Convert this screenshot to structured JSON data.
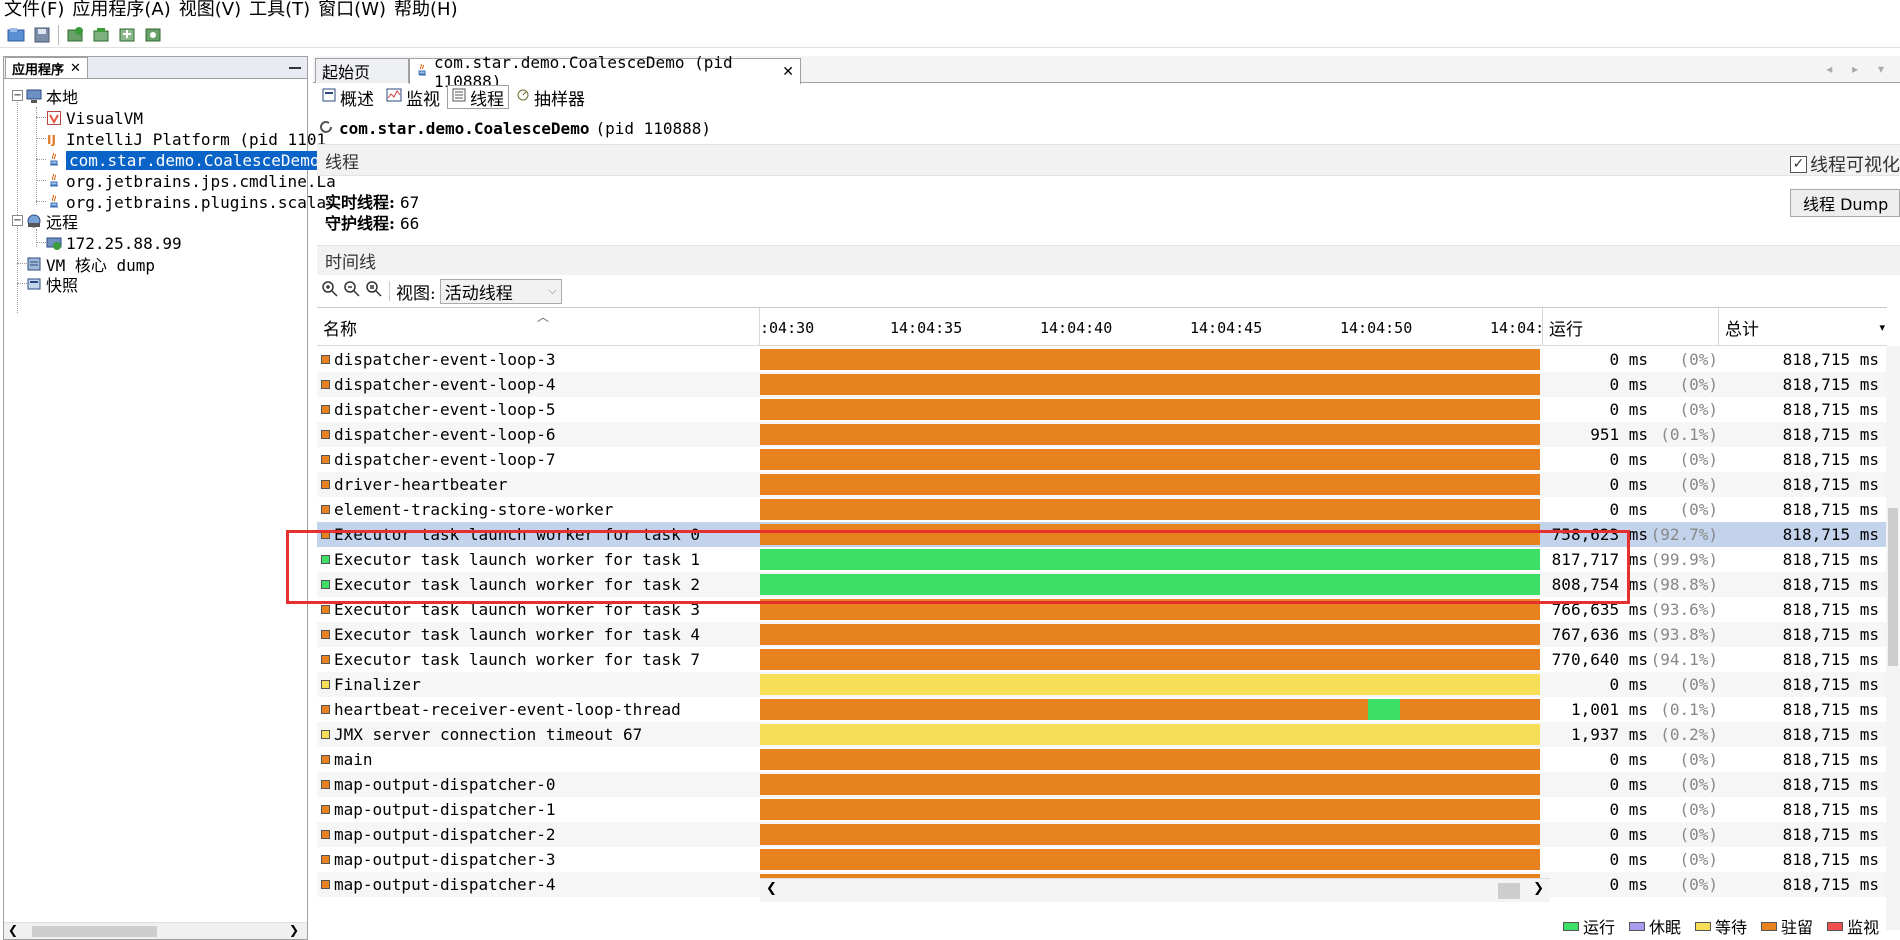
{
  "menu": [
    "文件(F)",
    "应用程序(A)",
    "视图(V)",
    "工具(T)",
    "窗口(W)",
    "帮助(H)"
  ],
  "left_panel": {
    "tab_label": "应用程序",
    "local": "本地",
    "local_items": [
      "VisualVM",
      "IntelliJ Platform (pid 1101",
      "com.star.demo.CoalesceDemo",
      "org.jetbrains.jps.cmdline.La",
      "org.jetbrains.plugins.scala."
    ],
    "remote": "远程",
    "remote_items": [
      "172.25.88.99"
    ],
    "vm_core_dump": "VM 核心 dump",
    "snapshots": "快照"
  },
  "doc_tabs": {
    "start_page": "起始页",
    "app_tab": "com.star.demo.CoalesceDemo (pid 110888)"
  },
  "sub_tabs": [
    "概述",
    "监视",
    "线程",
    "抽样器"
  ],
  "app_header": {
    "name": "com.star.demo.CoalesceDemo",
    "pid": "(pid 110888)"
  },
  "threads_section": {
    "title": "线程",
    "visualize_label": "线程可视化",
    "live_label": "实时线程:",
    "live_value": "67",
    "daemon_label": "守护线程:",
    "daemon_value": "66",
    "dump_button": "线程 Dump"
  },
  "timeline_section": {
    "title": "时间线",
    "view_label": "视图:",
    "view_value": "活动线程"
  },
  "table": {
    "col_name": "名称",
    "col_running": "运行",
    "col_total": "总计",
    "ticks": [
      ":04:30",
      "14:04:35",
      "14:04:40",
      "14:04:45",
      "14:04:50",
      "14:04:"
    ],
    "rows": [
      {
        "name": "dispatcher-event-loop-3",
        "state": "park",
        "run": "0 ms",
        "pct": "(0%)",
        "total": "818,715 ms"
      },
      {
        "name": "dispatcher-event-loop-4",
        "state": "park",
        "run": "0 ms",
        "pct": "(0%)",
        "total": "818,715 ms"
      },
      {
        "name": "dispatcher-event-loop-5",
        "state": "park",
        "run": "0 ms",
        "pct": "(0%)",
        "total": "818,715 ms"
      },
      {
        "name": "dispatcher-event-loop-6",
        "state": "park",
        "run": "951 ms",
        "pct": "(0.1%)",
        "total": "818,715 ms"
      },
      {
        "name": "dispatcher-event-loop-7",
        "state": "park",
        "run": "0 ms",
        "pct": "(0%)",
        "total": "818,715 ms"
      },
      {
        "name": "driver-heartbeater",
        "state": "park",
        "run": "0 ms",
        "pct": "(0%)",
        "total": "818,715 ms"
      },
      {
        "name": "element-tracking-store-worker",
        "state": "park",
        "run": "0 ms",
        "pct": "(0%)",
        "total": "818,715 ms"
      },
      {
        "name": "Executor task launch worker for task 0",
        "state": "park",
        "run": "758,623 ms",
        "pct": "(92.7%)",
        "total": "818,715 ms",
        "selected": true
      },
      {
        "name": "Executor task launch worker for task 1",
        "state": "run",
        "run": "817,717 ms",
        "pct": "(99.9%)",
        "total": "818,715 ms"
      },
      {
        "name": "Executor task launch worker for task 2",
        "state": "run",
        "run": "808,754 ms",
        "pct": "(98.8%)",
        "total": "818,715 ms"
      },
      {
        "name": "Executor task launch worker for task 3",
        "state": "park",
        "run": "766,635 ms",
        "pct": "(93.6%)",
        "total": "818,715 ms"
      },
      {
        "name": "Executor task launch worker for task 4",
        "state": "park",
        "run": "767,636 ms",
        "pct": "(93.8%)",
        "total": "818,715 ms"
      },
      {
        "name": "Executor task launch worker for task 7",
        "state": "park",
        "run": "770,640 ms",
        "pct": "(94.1%)",
        "total": "818,715 ms"
      },
      {
        "name": "Finalizer",
        "state": "wait",
        "run": "0 ms",
        "pct": "(0%)",
        "total": "818,715 ms"
      },
      {
        "name": "heartbeat-receiver-event-loop-thread",
        "state": "park",
        "run": "1,001 ms",
        "pct": "(0.1%)",
        "total": "818,715 ms",
        "run_blip": 0.78
      },
      {
        "name": "JMX server connection timeout 67",
        "state": "wait",
        "run": "1,937 ms",
        "pct": "(0.2%)",
        "total": "818,715 ms"
      },
      {
        "name": "main",
        "state": "park",
        "run": "0 ms",
        "pct": "(0%)",
        "total": "818,715 ms"
      },
      {
        "name": "map-output-dispatcher-0",
        "state": "park",
        "run": "0 ms",
        "pct": "(0%)",
        "total": "818,715 ms"
      },
      {
        "name": "map-output-dispatcher-1",
        "state": "park",
        "run": "0 ms",
        "pct": "(0%)",
        "total": "818,715 ms"
      },
      {
        "name": "map-output-dispatcher-2",
        "state": "park",
        "run": "0 ms",
        "pct": "(0%)",
        "total": "818,715 ms"
      },
      {
        "name": "map-output-dispatcher-3",
        "state": "park",
        "run": "0 ms",
        "pct": "(0%)",
        "total": "818,715 ms"
      },
      {
        "name": "map-output-dispatcher-4",
        "state": "park",
        "run": "0 ms",
        "pct": "(0%)",
        "total": "818,715 ms"
      }
    ]
  },
  "legend": [
    {
      "label": "运行",
      "state": "run"
    },
    {
      "label": "休眠",
      "state": "sleep"
    },
    {
      "label": "等待",
      "state": "wait"
    },
    {
      "label": "驻留",
      "state": "park"
    },
    {
      "label": "监视",
      "state": "monitor"
    }
  ],
  "colors": {
    "run": "#3ce066",
    "sleep": "#a89cf0",
    "wait": "#f6df57",
    "park": "#e8821e",
    "monitor": "#f05050",
    "selection": "#0a64c8",
    "highlight_box": "#e53030"
  }
}
